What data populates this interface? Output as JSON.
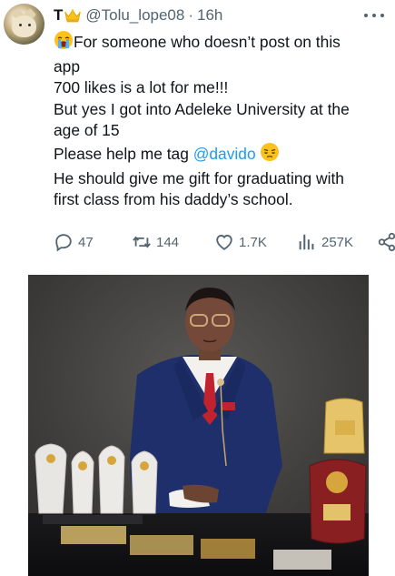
{
  "tweet": {
    "display_name": "T",
    "handle": "@Tolu_lope08",
    "separator": "·",
    "time": "16h",
    "avatar_icon": "cat-avatar",
    "badge_icon": "crown-icon",
    "more_icon": "more-dots-icon",
    "text": {
      "line1": "For someone who doesn’t post on this",
      "line2": "app",
      "line3": "700 likes is a lot for me!!!",
      "line4": "But yes I got into Adeleke University at the",
      "line5": "age of 15",
      "line6_pre": "Please help me tag ",
      "line6_mention": "@davido",
      "line7": "He should give me gift for graduating with",
      "line8": "first class from his daddy’s school.",
      "emoji1": "crying-face-emoji",
      "emoji2": "relieved-face-emoji"
    },
    "actions": {
      "replies": "47",
      "retweets": "144",
      "likes": "1.7K",
      "views": "257K"
    },
    "colors": {
      "text": "#0f1419",
      "secondary": "#536471",
      "link": "#1d9bf0",
      "crown": "#f7c21c"
    },
    "photo": {
      "description_icon": "graduate-with-awards-photo"
    }
  }
}
